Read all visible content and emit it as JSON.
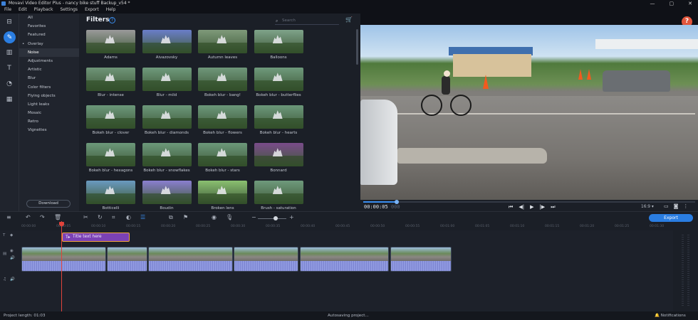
{
  "window": {
    "title": "Movavi Video Editor Plus - nancy bike stuff Backup_v54 *",
    "controls": [
      "—",
      "▢",
      "✕"
    ]
  },
  "menu": [
    "File",
    "Edit",
    "Playback",
    "Settings",
    "Export",
    "Help"
  ],
  "left_toolbar": [
    "import-icon",
    "filters-icon",
    "transitions-icon",
    "titles-icon",
    "stickers-icon",
    "more-tools-icon"
  ],
  "categories": [
    {
      "label": "All",
      "selected": false
    },
    {
      "label": "Favorites",
      "selected": false
    },
    {
      "label": "Featured",
      "selected": false
    },
    {
      "label": "Overlay",
      "selected": false,
      "bullet": true
    },
    {
      "label": "Noise",
      "selected": true
    },
    {
      "label": "Adjustments",
      "selected": false
    },
    {
      "label": "Artistic",
      "selected": false
    },
    {
      "label": "Blur",
      "selected": false
    },
    {
      "label": "Color filters",
      "selected": false
    },
    {
      "label": "Flying objects",
      "selected": false
    },
    {
      "label": "Light leaks",
      "selected": false
    },
    {
      "label": "Mosaic",
      "selected": false
    },
    {
      "label": "Retro",
      "selected": false
    },
    {
      "label": "Vignettes",
      "selected": false
    }
  ],
  "download_label": "Download",
  "filters": {
    "title": "Filters",
    "help": "?",
    "search_placeholder": "Search",
    "items": [
      {
        "label": "Adams",
        "tint": "#9a9a9a"
      },
      {
        "label": "Aivazovsky",
        "tint": "#6a7ec9"
      },
      {
        "label": "Autumn leaves",
        "tint": "#7f9a7a"
      },
      {
        "label": "Balloons",
        "tint": "#7fa38a"
      },
      {
        "label": "Blur - intense",
        "tint": "#6f9578"
      },
      {
        "label": "Blur - mild",
        "tint": "#6f9a7c"
      },
      {
        "label": "Bokeh blur - bang!",
        "tint": "#6f977a"
      },
      {
        "label": "Bokeh blur - butterflies",
        "tint": "#6f9a7c"
      },
      {
        "label": "Bokeh blur - clover",
        "tint": "#6c987a"
      },
      {
        "label": "Bokeh blur - diamonds",
        "tint": "#6c987a"
      },
      {
        "label": "Bokeh blur - flowers",
        "tint": "#6c987a"
      },
      {
        "label": "Bokeh blur - hearts",
        "tint": "#6c987a"
      },
      {
        "label": "Bokeh blur - hexagons",
        "tint": "#6c987a"
      },
      {
        "label": "Bokeh blur - snowflakes",
        "tint": "#6c987a"
      },
      {
        "label": "Bokeh blur - stars",
        "tint": "#6c987a"
      },
      {
        "label": "Bonnard",
        "tint": "#7a4b8a"
      },
      {
        "label": "Botticelli",
        "tint": "#6a9ac0"
      },
      {
        "label": "Boudin",
        "tint": "#8a7fd0"
      },
      {
        "label": "Broken lens",
        "tint": "#8ac070"
      },
      {
        "label": "Brush - saturation",
        "tint": "#6f9a7c"
      }
    ]
  },
  "player": {
    "timecode": "00:00:05",
    "timecode_dim": "000",
    "position_fraction": 0.1,
    "aspect": "16:9 ▾",
    "help": "?"
  },
  "toolbar": {
    "export_label": "Export"
  },
  "ruler_ticks": [
    "00:00:00",
    "00:00:05",
    "00:00:10",
    "00:00:15",
    "00:00:20",
    "00:00:25",
    "00:00:30",
    "00:00:35",
    "00:00:40",
    "00:00:45",
    "00:00:50",
    "00:00:55",
    "00:01:00",
    "00:01:05",
    "00:01:10",
    "00:01:15",
    "00:01:20",
    "00:01:25",
    "00:01:30"
  ],
  "timeline": {
    "title_clip": "Title text here"
  },
  "status": {
    "project_length": "Project length: 01:03",
    "autosave": "Autosaving project...",
    "notifications": "Notifications"
  }
}
